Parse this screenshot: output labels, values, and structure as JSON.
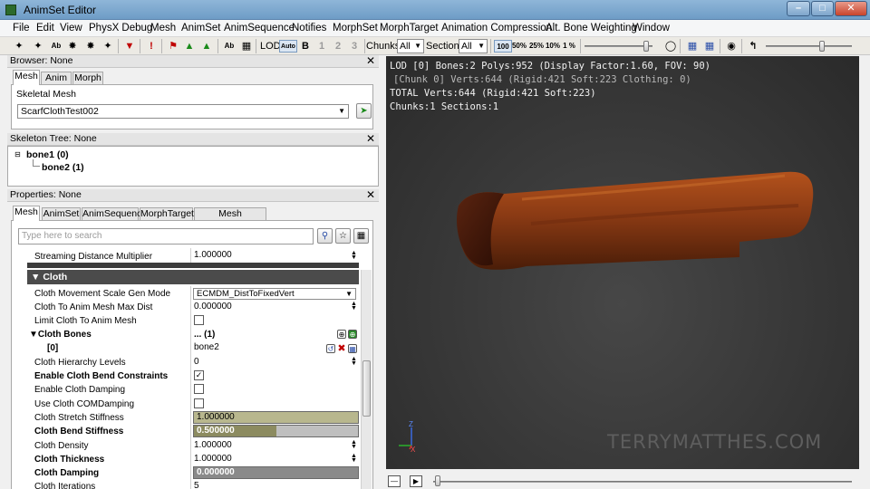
{
  "window": {
    "title": "AnimSet Editor"
  },
  "menu": [
    "File",
    "Edit",
    "View",
    "PhysX Debug",
    "Mesh",
    "AnimSet",
    "AnimSequence",
    "Notifies",
    "MorphSet",
    "MorphTarget",
    "Animation Compression",
    "Alt. Bone Weighting",
    "Window"
  ],
  "toolbar": {
    "lod_label": "LOD:",
    "lod_auto": "Auto",
    "lod_base": "B",
    "lod_levels": [
      "1",
      "2",
      "3"
    ],
    "chunks_label": "Chunks:",
    "chunks_value": "All",
    "sections_label": "Sections:",
    "sections_value": "All",
    "percents": [
      "100",
      "50%",
      "25%",
      "10%",
      "1 %"
    ]
  },
  "browser": {
    "header": "Browser: None",
    "tabs": [
      "Mesh",
      "Anim",
      "Morph"
    ],
    "field_label": "Skeletal Mesh",
    "mesh_value": "ScarfClothTest002"
  },
  "skeleton_tree": {
    "header": "Skeleton Tree: None",
    "bones": [
      "bone1 (0)",
      "bone2 (1)"
    ]
  },
  "properties": {
    "header": "Properties: None",
    "tabs": [
      "Mesh",
      "AnimSet",
      "AnimSequence",
      "MorphTarget",
      "Mesh Simplification"
    ],
    "search_placeholder": "Type here to search",
    "streaming_label": "Streaming Distance Multiplier",
    "streaming_value": "1.000000",
    "category": "Cloth",
    "rows": {
      "movement_mode_label": "Cloth Movement Scale Gen Mode",
      "movement_mode_value": "ECMDM_DistToFixedVert",
      "max_dist_label": "Cloth To Anim Mesh Max Dist",
      "max_dist_value": "0.000000",
      "limit_label": "Limit Cloth To Anim Mesh",
      "cloth_bones_label": "Cloth Bones",
      "cloth_bones_value": "... (1)",
      "bone_index_label": "[0]",
      "bone_index_value": "bone2",
      "hierarchy_label": "Cloth Hierarchy Levels",
      "hierarchy_value": "0",
      "bend_constraints_label": "Enable Cloth Bend Constraints",
      "damping_enable_label": "Enable Cloth Damping",
      "com_damping_label": "Use Cloth COMDamping",
      "stretch_label": "Cloth Stretch Stiffness",
      "stretch_value": "1.000000",
      "stretch_fill": 1.0,
      "bend_label": "Cloth Bend Stiffness",
      "bend_value": "0.500000",
      "bend_fill": 0.5,
      "density_label": "Cloth Density",
      "density_value": "1.000000",
      "thickness_label": "Cloth Thickness",
      "thickness_value": "1.000000",
      "damping_label": "Cloth Damping",
      "damping_value": "0.000000",
      "iterations_label": "Cloth Iterations",
      "iterations_value": "5"
    },
    "checked": {
      "limit": false,
      "bend_constraints": true,
      "damping": false,
      "com_damping": false
    }
  },
  "viewport": {
    "line1": "LOD [0] Bones:2 Polys:952 (Display Factor:1.60, FOV: 90)",
    "line2": "[Chunk 0] Verts:644 (Rigid:421 Soft:223 Clothing: 0)",
    "line3": "TOTAL Verts:644 (Rigid:421 Soft:223)",
    "line4": "Chunks:1 Sections:1",
    "watermark": "TERRYMATTHES.COM",
    "axis_z": "Z",
    "axis_x": "X",
    "mesh_color": "#8a3a14"
  },
  "colors": {
    "titlebar": "#7aa7d0",
    "category": "#4b4b4b",
    "viewport_bg": "#3a3a3a"
  }
}
